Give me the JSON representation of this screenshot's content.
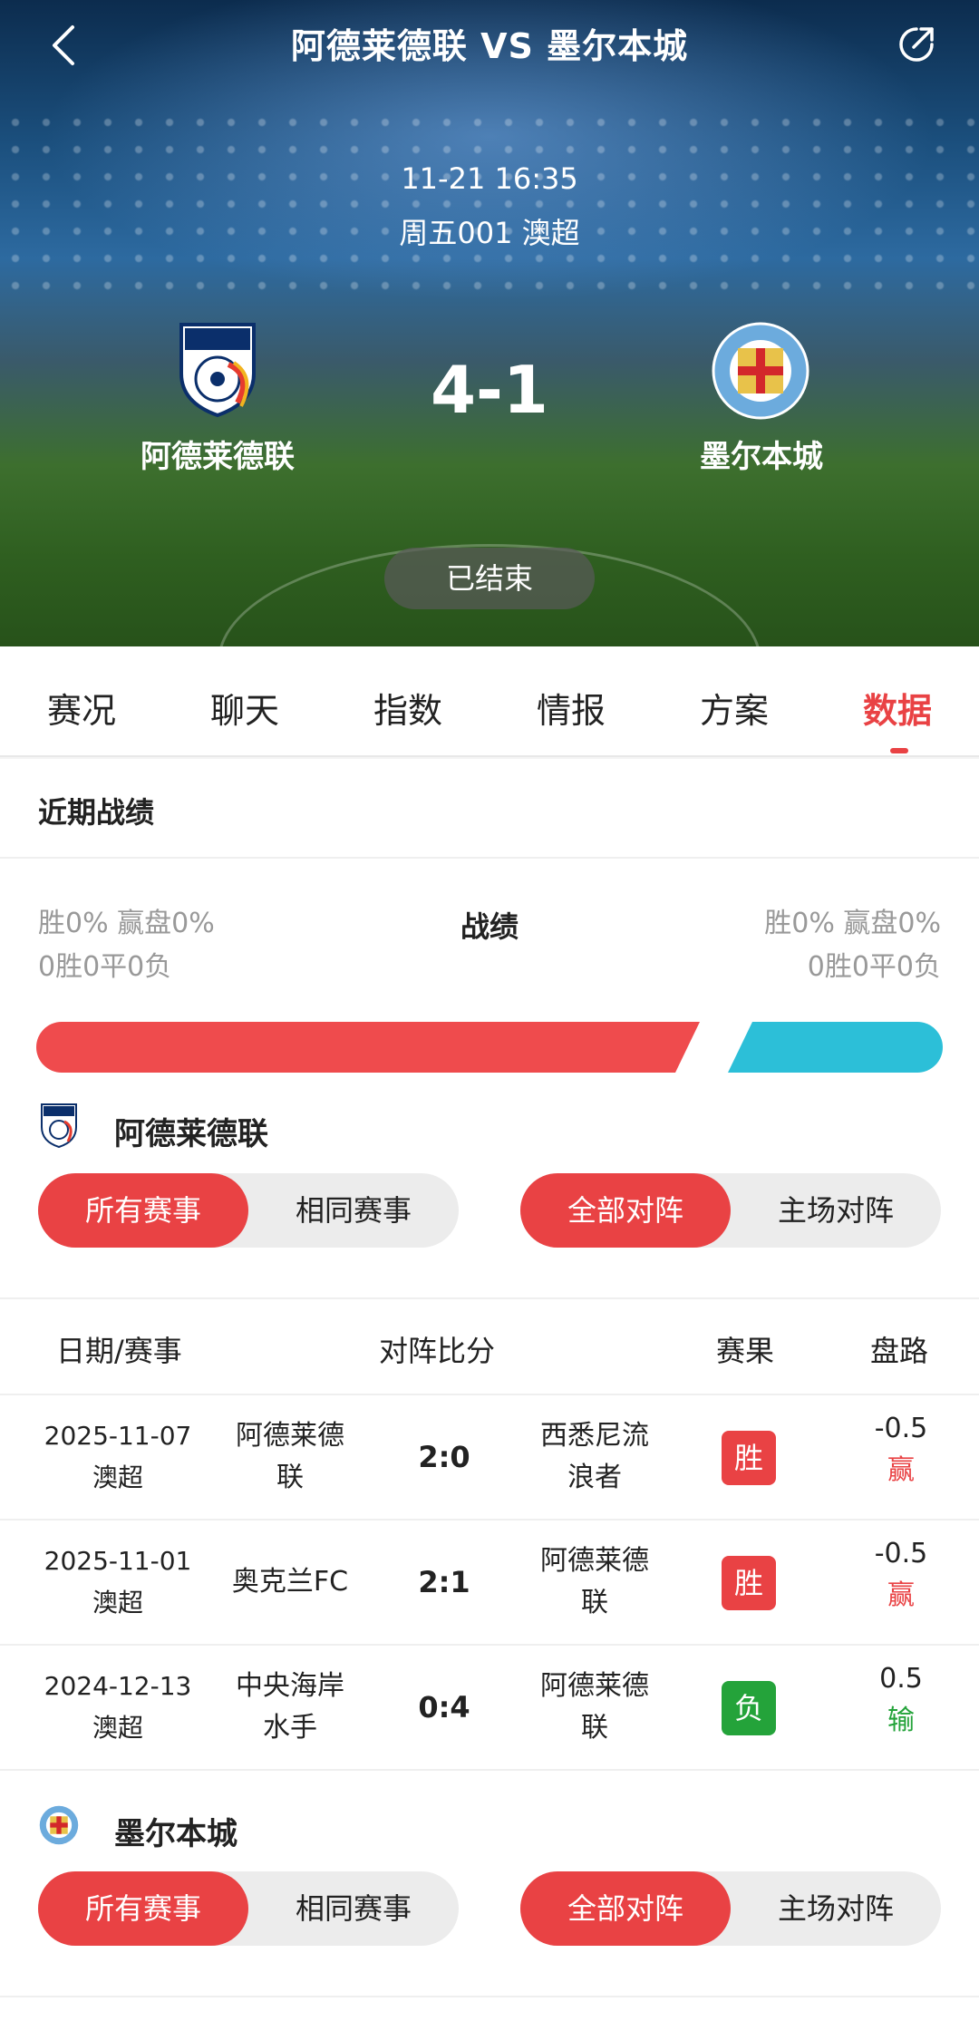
{
  "header": {
    "title": "阿德莱德联 VS 墨尔本城",
    "match_time": "11-21 16:35",
    "match_league": "周五001 澳超",
    "home_team": "阿德莱德联",
    "away_team": "墨尔本城",
    "score": "4-1",
    "status": "已结束"
  },
  "tabs": [
    "赛况",
    "聊天",
    "指数",
    "情报",
    "方案",
    "数据"
  ],
  "active_tab": "数据",
  "recent": {
    "title": "近期战绩",
    "center_label": "战绩",
    "left_line1": "胜0% 赢盘0%",
    "left_line2": "0胜0平0负",
    "right_line1": "胜0% 赢盘0%",
    "right_line2": "0胜0平0负",
    "bar_home_color": "#ef4b4d",
    "bar_away_color": "#2cbfd8"
  },
  "home_section": {
    "team": "阿德莱德联",
    "filter_left": [
      "所有赛事",
      "相同赛事"
    ],
    "filter_right": [
      "全部对阵",
      "主场对阵"
    ]
  },
  "table": {
    "headers": [
      "日期/赛事",
      "对阵比分",
      "赛果",
      "盘路"
    ],
    "rows": [
      {
        "date": "2025-11-07",
        "league": "澳超",
        "home1": "阿德莱德",
        "home2": "联",
        "score": "2:0",
        "away1": "西悉尼流",
        "away2": "浪者",
        "result": "胜",
        "result_color": "#e94244",
        "hcp": "-0.5",
        "hcp_result": "赢"
      },
      {
        "date": "2025-11-01",
        "league": "澳超",
        "home1": "奥克兰FC",
        "home2": "",
        "score": "2:1",
        "away1": "阿德莱德",
        "away2": "联",
        "result": "胜",
        "result_color": "#e94244",
        "hcp": "-0.5",
        "hcp_result": "赢"
      },
      {
        "date": "2024-12-13",
        "league": "澳超",
        "home1": "中央海岸",
        "home2": "水手",
        "score": "0:4",
        "away1": "阿德莱德",
        "away2": "联",
        "result": "负",
        "result_color": "#24a33a",
        "hcp": "0.5",
        "hcp_result": "输"
      }
    ]
  },
  "away_section": {
    "team": "墨尔本城",
    "filter_left": [
      "所有赛事",
      "相同赛事"
    ],
    "filter_right": [
      "全部对阵",
      "主场对阵"
    ]
  },
  "icons": {
    "back": "chevron-left-icon",
    "share": "share-icon"
  }
}
